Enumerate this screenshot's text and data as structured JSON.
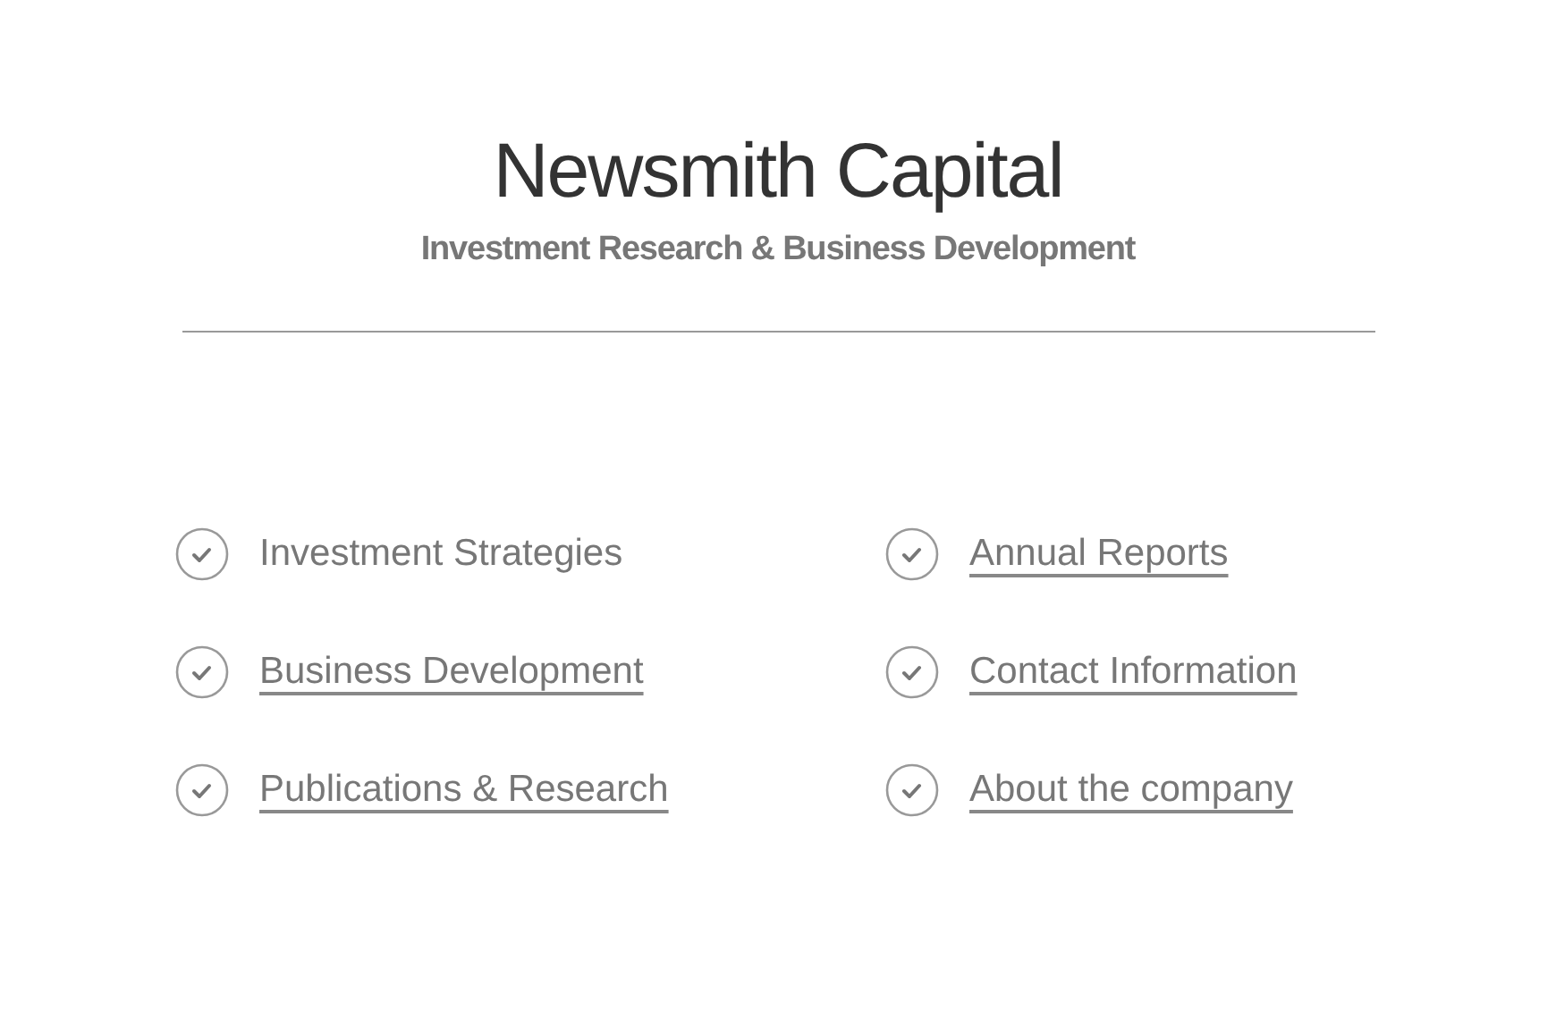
{
  "header": {
    "title": "Newsmith Capital",
    "subtitle": "Investment Research & Business Development"
  },
  "links": [
    {
      "label": "Investment Strategies",
      "linked": false
    },
    {
      "label": "Annual Reports",
      "linked": true
    },
    {
      "label": "Business Development",
      "linked": true
    },
    {
      "label": "Contact Information",
      "linked": true
    },
    {
      "label": "Publications & Research",
      "linked": true
    },
    {
      "label": "About the company",
      "linked": true
    }
  ]
}
